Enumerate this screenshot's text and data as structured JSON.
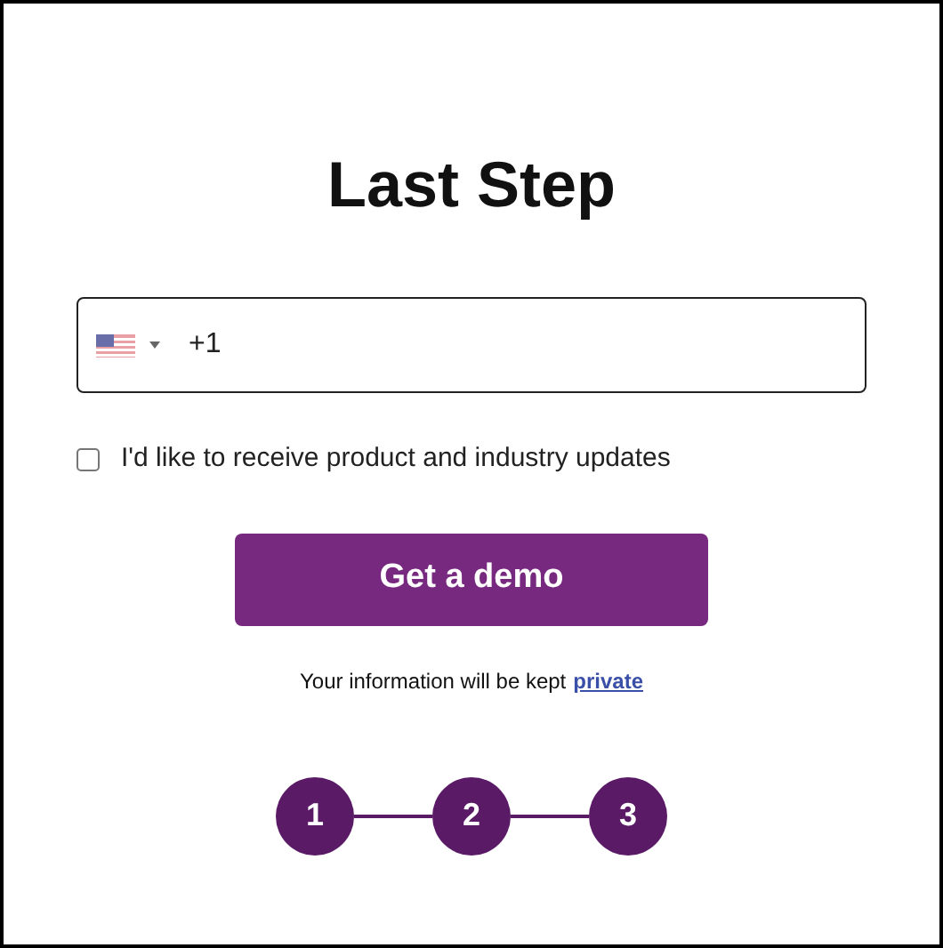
{
  "title": "Last Step",
  "phone": {
    "value": "+1"
  },
  "consent": {
    "label": "I'd like to receive product and industry updates",
    "checked": false
  },
  "submit": {
    "label": "Get a demo"
  },
  "privacy": {
    "text": "Your information will be kept",
    "link": "private"
  },
  "steps": [
    {
      "label": "1"
    },
    {
      "label": "2"
    },
    {
      "label": "3"
    }
  ]
}
